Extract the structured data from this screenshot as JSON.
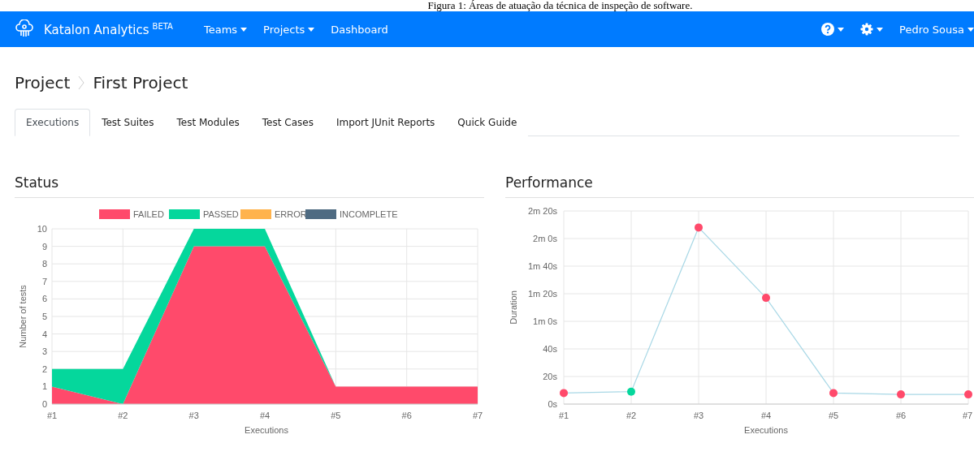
{
  "caption": "Figura 1: Áreas de atuação da técnica de inspeção de software.",
  "navbar": {
    "brand": "Katalon Analytics",
    "badge": "BETA",
    "menu": [
      {
        "label": "Teams",
        "dropdown": true
      },
      {
        "label": "Projects",
        "dropdown": true
      },
      {
        "label": "Dashboard",
        "dropdown": false
      }
    ],
    "user": "Pedro Sousa"
  },
  "breadcrumb": [
    "Project",
    "First Project"
  ],
  "tabs": [
    {
      "label": "Executions",
      "selected": true
    },
    {
      "label": "Test Suites",
      "selected": false
    },
    {
      "label": "Test Modules",
      "selected": false
    },
    {
      "label": "Test Cases",
      "selected": false
    },
    {
      "label": "Import JUnit Reports",
      "selected": false
    },
    {
      "label": "Quick Guide",
      "selected": false
    }
  ],
  "status": {
    "title": "Status",
    "chart_data": {
      "type": "area",
      "stacked": true,
      "grid": true,
      "legend": true,
      "xlabel": "Executions",
      "ylabel": "Number of tests",
      "categories": [
        "#1",
        "#2",
        "#3",
        "#4",
        "#5",
        "#6",
        "#7"
      ],
      "ylim": [
        0,
        10
      ],
      "yticks": [
        0,
        1,
        2,
        3,
        4,
        5,
        6,
        7,
        8,
        9,
        10
      ],
      "series": [
        {
          "name": "FAILED",
          "color": "#ff4a6b",
          "values": [
            1,
            0,
            9,
            9,
            1,
            1,
            1
          ]
        },
        {
          "name": "PASSED",
          "color": "#05d79c",
          "values": [
            1,
            2,
            1,
            1,
            0,
            0,
            0
          ]
        },
        {
          "name": "ERROR",
          "color": "#ffb34d",
          "values": [
            null,
            null,
            null,
            null,
            null,
            null,
            null
          ]
        },
        {
          "name": "INCOMPLETE",
          "color": "#4f6b82",
          "values": [
            null,
            null,
            null,
            null,
            null,
            null,
            null
          ]
        }
      ]
    }
  },
  "performance": {
    "title": "Performance",
    "runs": [
      {
        "color": "#ff4a6b"
      },
      {
        "color": "#05d79c"
      },
      {
        "color": "#ff4a6b"
      },
      {
        "color": "#ff4a6b"
      },
      {
        "color": "#ff4a6b"
      },
      {
        "color": "#ff4a6b"
      },
      {
        "color": "#ff4a6b"
      }
    ],
    "chart_data": {
      "type": "line",
      "grid": true,
      "xlabel": "Executions",
      "ylabel": "Duration",
      "categories": [
        "#1",
        "#2",
        "#3",
        "#4",
        "#5",
        "#6",
        "#7"
      ],
      "ylim": [
        0,
        140
      ],
      "yticks": [
        {
          "value": 0,
          "label": "0s"
        },
        {
          "value": 20,
          "label": "20s"
        },
        {
          "value": 40,
          "label": "40s"
        },
        {
          "value": 60,
          "label": "1m 0s"
        },
        {
          "value": 80,
          "label": "1m 20s"
        },
        {
          "value": 100,
          "label": "1m 40s"
        },
        {
          "value": 120,
          "label": "2m 0s"
        },
        {
          "value": 140,
          "label": "2m 20s"
        }
      ],
      "series": [
        {
          "color": "#a9d8e6",
          "marker": true,
          "values": [
            8,
            9,
            128,
            77,
            8,
            7,
            7
          ]
        }
      ]
    }
  }
}
